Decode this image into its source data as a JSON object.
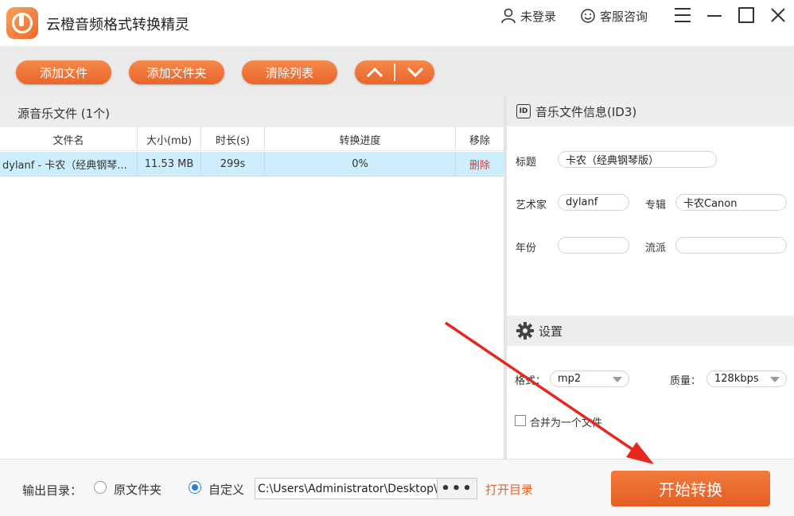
{
  "app": {
    "title": "云橙音频格式转换精灵",
    "login_label": "未登录",
    "support_label": "客服咨询"
  },
  "toolbar": {
    "add_file": "添加文件",
    "add_folder": "添加文件夹",
    "clear_list": "清除列表"
  },
  "file_list": {
    "header": "源音乐文件 (1个)",
    "columns": [
      "文件名",
      "大小(mb)",
      "时长(s)",
      "转换进度",
      "移除"
    ],
    "rows": [
      {
        "name": "dylanf - 卡农（经典钢琴...",
        "size": "11.53 MB",
        "duration": "299s",
        "progress": "0%",
        "remove": "删除"
      }
    ]
  },
  "id3": {
    "header": "音乐文件信息(ID3)",
    "id_badge": "ID",
    "title_label": "标题",
    "title_value": "卡农（经典钢琴版）",
    "artist_label": "艺术家",
    "artist_value": "dylanf",
    "album_label": "专辑",
    "album_value": "卡农Canon",
    "year_label": "年份",
    "year_value": "",
    "genre_label": "流派",
    "genre_value": ""
  },
  "settings": {
    "header": "设置",
    "format_label": "格式：",
    "format_value": "mp2",
    "quality_label": "质量：",
    "quality_value": "128kbps",
    "merge_label": "合并为一个文件"
  },
  "output": {
    "label": "输出目录：",
    "option_original": "原文件夹",
    "option_custom": "自定义",
    "selected": "custom",
    "path": "C:\\Users\\Administrator\\Desktop\\",
    "browse": "•••",
    "open_dir": "打开目录",
    "start": "开始转换"
  },
  "colors": {
    "accent": "#e9642a",
    "row_highlight": "#cdeefd",
    "delete": "#e03a2e",
    "annotation": "#e8281e"
  }
}
